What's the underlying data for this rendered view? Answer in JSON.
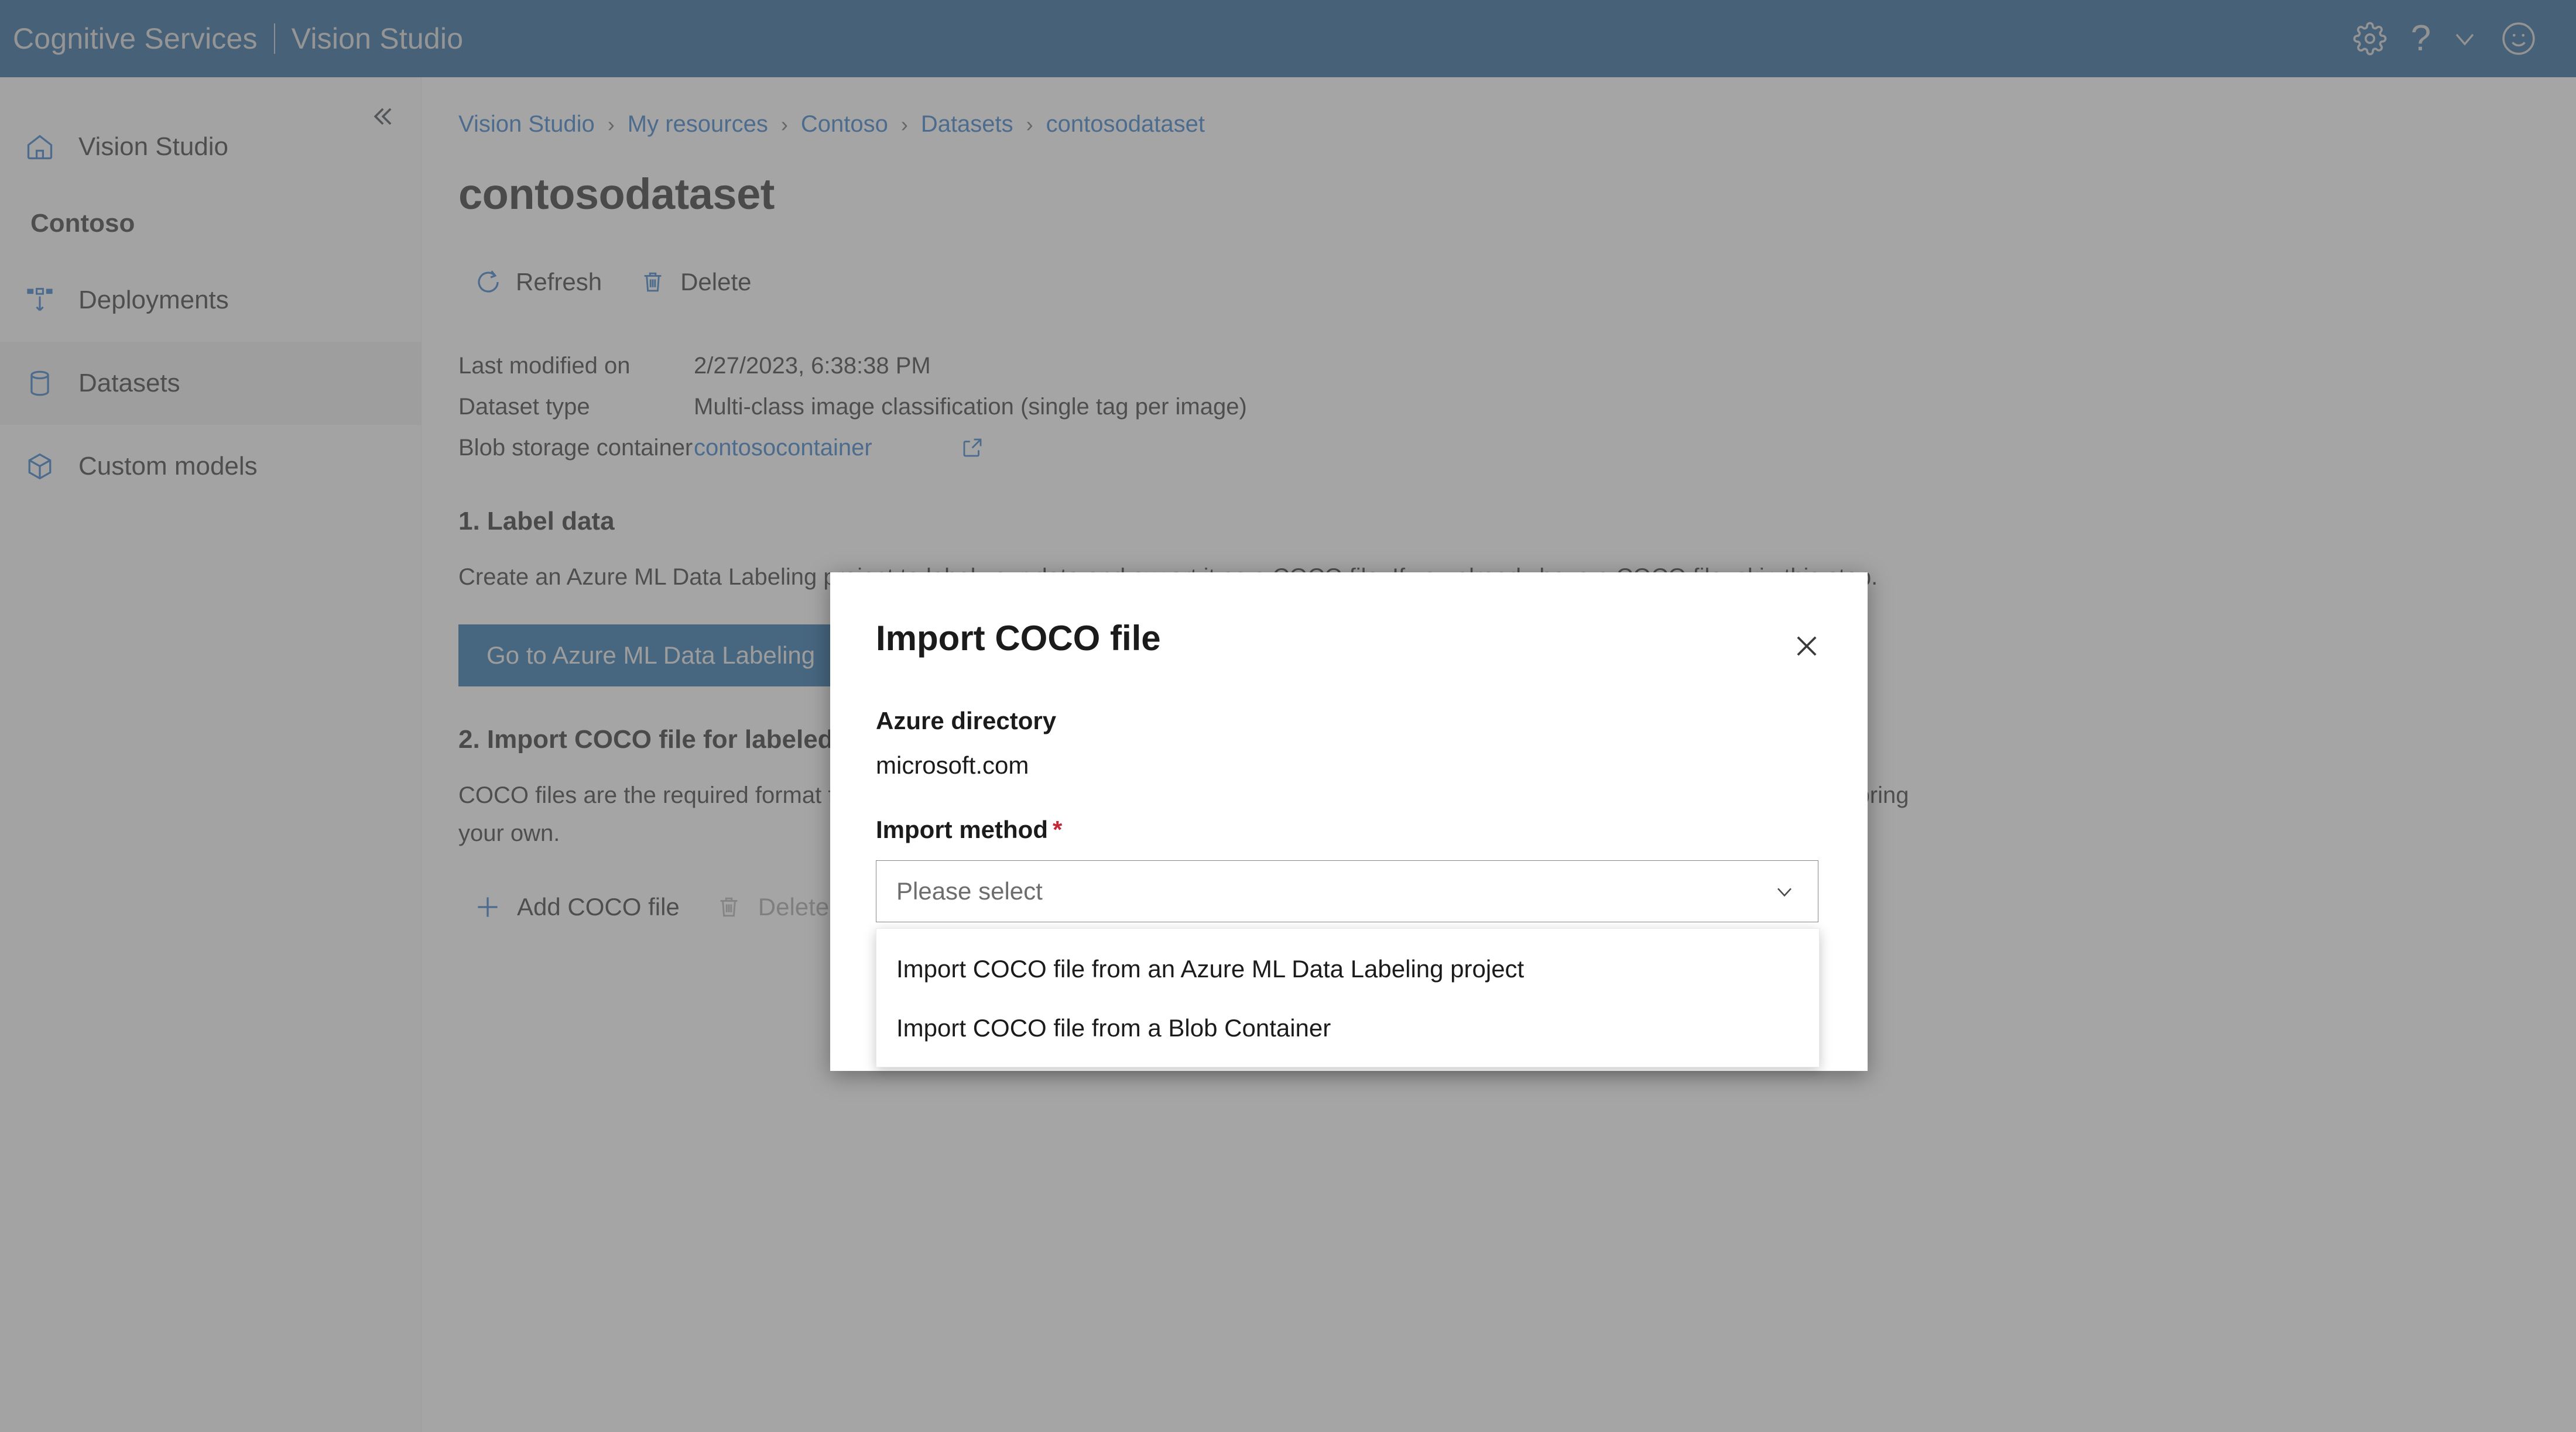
{
  "topbar": {
    "brand_primary": "Cognitive Services",
    "brand_secondary": "Vision Studio",
    "icons": {
      "settings": "gear-icon",
      "help": "?",
      "chevron": "chevron-down-icon",
      "feedback": "smiley-face-icon"
    }
  },
  "sidebar": {
    "collapse_label": "«",
    "home_item": {
      "label": "Vision Studio",
      "icon": "home-icon"
    },
    "group_title": "Contoso",
    "items": [
      {
        "label": "Deployments",
        "icon": "deployments-icon",
        "active": false
      },
      {
        "label": "Datasets",
        "icon": "database-icon",
        "active": true
      },
      {
        "label": "Custom models",
        "icon": "cube-icon",
        "active": false
      }
    ]
  },
  "breadcrumb": [
    "Vision Studio",
    "My resources",
    "Contoso",
    "Datasets",
    "contosodataset"
  ],
  "breadcrumb_separator": "›",
  "page": {
    "title": "contosodataset"
  },
  "toolbar": {
    "refresh_label": "Refresh",
    "delete_label": "Delete"
  },
  "metadata": [
    {
      "label": "Last modified on",
      "value": "2/27/2023, 6:38:38 PM",
      "is_link": false
    },
    {
      "label": "Dataset type",
      "value": "Multi-class image classification (single tag per image)",
      "is_link": false
    },
    {
      "label": "Blob storage container",
      "value": "contosocontainer",
      "is_link": true
    }
  ],
  "sections": [
    {
      "title": "1. Label data",
      "body": "Create an Azure ML Data Labeling project to label your data and export it as a COCO file. If you already have a COCO file, skip this step.",
      "button": "Go to Azure ML Data Labeling"
    },
    {
      "title": "2. Import COCO file for labeled data",
      "body": "COCO files are the required format for importing labeled data. You can export COCO files from your Azure ML Data Labeling project or bring your own.",
      "add_label": "Add COCO file",
      "delete_label": "Delete"
    }
  ],
  "modal": {
    "title": "Import COCO file",
    "close_icon": "close-icon",
    "azure_directory_label": "Azure directory",
    "azure_directory_value": "microsoft.com",
    "import_method_label": "Import method",
    "required_marker": "*",
    "select_placeholder": "Please select",
    "chevron_icon": "chevron-down-icon",
    "options": [
      "Import COCO file from an Azure ML Data Labeling project",
      "Import COCO file from a Blob Container"
    ]
  },
  "colors": {
    "topbar_blue": "#0a4d8c",
    "accent_blue": "#1668c1",
    "primary_button": "#0a5a9c",
    "required_red": "#c2283a",
    "sidebar_active": "#ededed"
  }
}
